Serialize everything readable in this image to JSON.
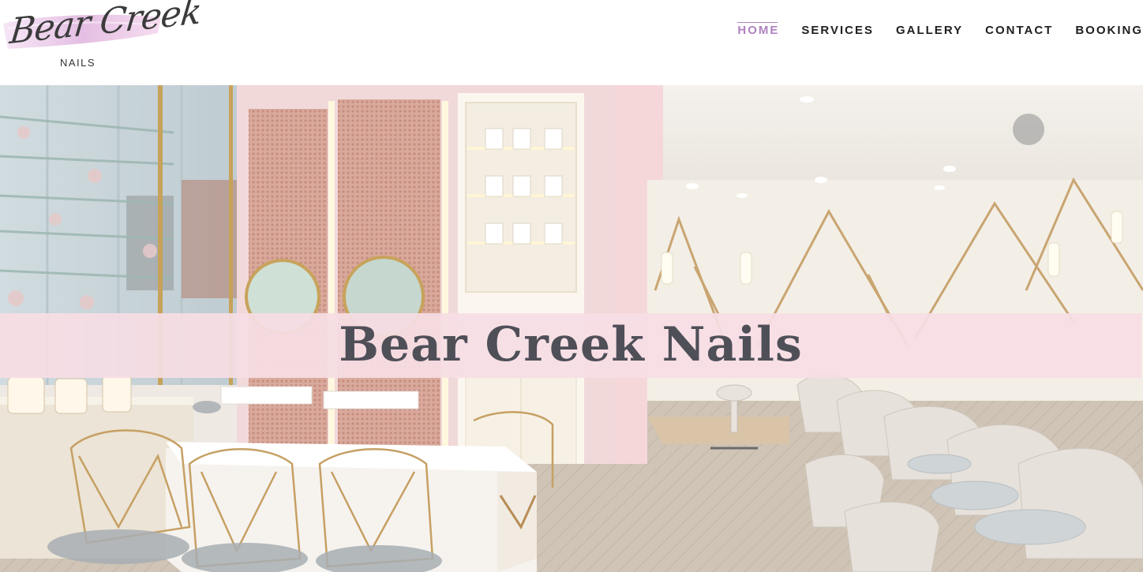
{
  "brand": {
    "script_name": "Bear Creek",
    "sub_name": "NAILS",
    "brush_color": "#e4b8e0"
  },
  "nav": {
    "items": [
      {
        "label": "HOME",
        "active": true
      },
      {
        "label": "SERVICES",
        "active": false
      },
      {
        "label": "GALLERY",
        "active": false
      },
      {
        "label": "CONTACT",
        "active": false
      },
      {
        "label": "BOOKING",
        "active": false
      }
    ],
    "active_color": "#b081c0",
    "text_color": "#1f1f1f"
  },
  "hero": {
    "title": "Bear Creek Nails",
    "image_subject": "nail salon interior",
    "banner_color": "#f6dee4"
  }
}
